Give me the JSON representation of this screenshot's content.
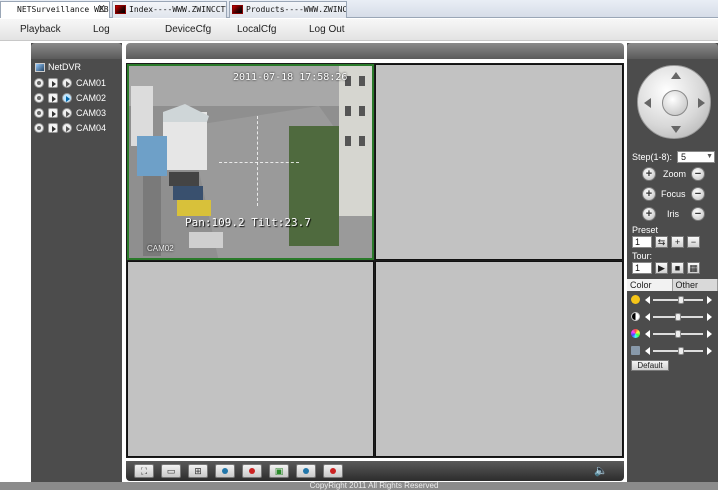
{
  "browser": {
    "tabs": [
      {
        "title": "NETSurveillance WEB",
        "close": "X"
      },
      {
        "title": "Index----WWW.ZWINCCTV...."
      },
      {
        "title": "Products----WWW.ZWINCC..."
      }
    ]
  },
  "menu": {
    "items": [
      "Playback",
      "Log",
      "DeviceCfg",
      "LocalCfg",
      "Log Out"
    ]
  },
  "device_tree": {
    "root": "NetDVR",
    "cameras": [
      {
        "name": "CAM01",
        "live": false
      },
      {
        "name": "CAM02",
        "live": true
      },
      {
        "name": "CAM03",
        "live": false
      },
      {
        "name": "CAM04",
        "live": false
      }
    ]
  },
  "video": {
    "cell1": {
      "timestamp": "2011-07-18 17:58:26",
      "pan_tilt": "Pan:109.2 Tilt:23.7",
      "channel": "CAM02"
    }
  },
  "ptz": {
    "step_label": "Step(1-8):",
    "step_value": "5",
    "zoom_label": "Zoom",
    "focus_label": "Focus",
    "iris_label": "Iris",
    "preset_label": "Preset",
    "preset_value": "1",
    "tour_label": "Tour:",
    "tour_value": "1"
  },
  "color_panel": {
    "tabs": [
      "Color",
      "Other"
    ],
    "active_tab": "Color",
    "sliders": [
      {
        "name": "brightness",
        "level": 0.55,
        "icon_color": "#f5c518"
      },
      {
        "name": "contrast",
        "level": 0.5,
        "icon_color": "#222222"
      },
      {
        "name": "saturation",
        "level": 0.5,
        "icon_color": "#c44cc4"
      },
      {
        "name": "hue",
        "level": 0.55,
        "icon_color": "#8899aa"
      }
    ],
    "default_label": "Default"
  },
  "footer": {
    "copyright": "CopyRight 2011 All Rights Reserved"
  },
  "colors": {
    "panel_bg": "#4c4c4c",
    "selected_cell_border": "#2a7a2a",
    "empty_cell": "#c2c2c2"
  }
}
